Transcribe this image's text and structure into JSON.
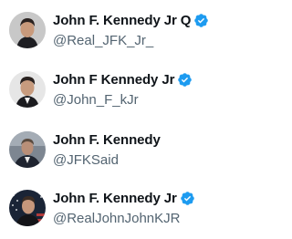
{
  "accounts": [
    {
      "name": "John F. Kennedy Jr Q",
      "handle": "@Real_JFK_Jr_",
      "verified": true
    },
    {
      "name": "John F Kennedy Jr",
      "handle": "@John_F_kJr",
      "verified": true
    },
    {
      "name": "John F. Kennedy",
      "handle": "@JFKSaid",
      "verified": false
    },
    {
      "name": "John F. Kennedy Jr",
      "handle": "@RealJohnJohnKJR",
      "verified": true
    }
  ],
  "colors": {
    "verified_badge": "#1d9bf0",
    "name_text": "#0f1419",
    "handle_text": "#536471"
  },
  "icons": {
    "verified": "verified-badge-icon"
  }
}
